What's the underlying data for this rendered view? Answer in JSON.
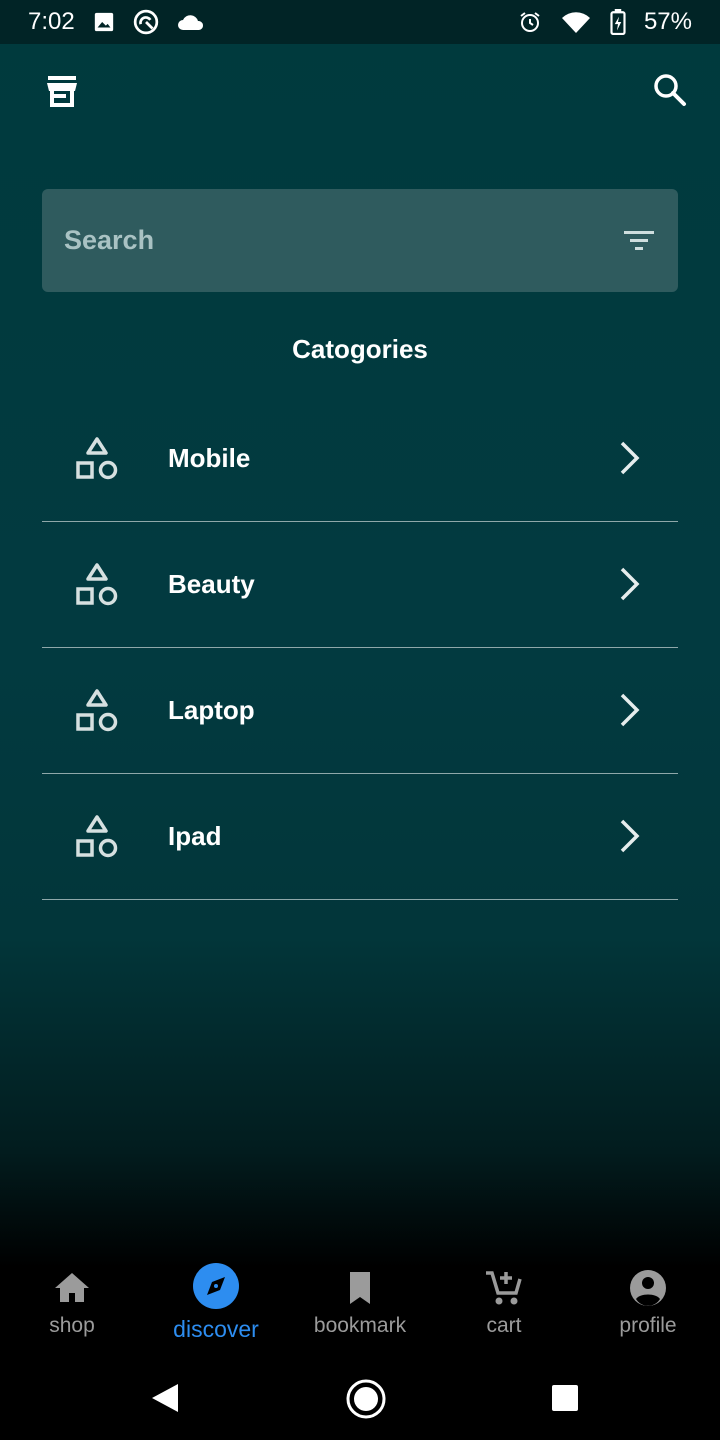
{
  "status_bar": {
    "time": "7:02",
    "battery": "57%",
    "icons": [
      "image-icon",
      "sync-icon",
      "cloud-icon",
      "alarm-icon",
      "wifi-icon",
      "battery-icon"
    ]
  },
  "app_bar": {
    "left_icon": "store-icon",
    "right_icon": "search-icon"
  },
  "search": {
    "placeholder": "Search",
    "filter_icon": "filter-icon"
  },
  "section_title": "Catogories",
  "categories": [
    {
      "label": "Mobile",
      "icon": "shapes-icon"
    },
    {
      "label": "Beauty",
      "icon": "shapes-icon"
    },
    {
      "label": "Laptop",
      "icon": "shapes-icon"
    },
    {
      "label": "Ipad",
      "icon": "shapes-icon"
    }
  ],
  "bottom_nav": [
    {
      "label": "shop",
      "icon": "home-icon",
      "active": false
    },
    {
      "label": "discover",
      "icon": "compass-icon",
      "active": true
    },
    {
      "label": "bookmark",
      "icon": "bookmark-icon",
      "active": false
    },
    {
      "label": "cart",
      "icon": "cart-icon",
      "active": false
    },
    {
      "label": "profile",
      "icon": "account-icon",
      "active": false
    }
  ],
  "colors": {
    "accent": "#2d8df0",
    "search_bg": "#2f5b5e",
    "background_top": "#003a3d"
  }
}
